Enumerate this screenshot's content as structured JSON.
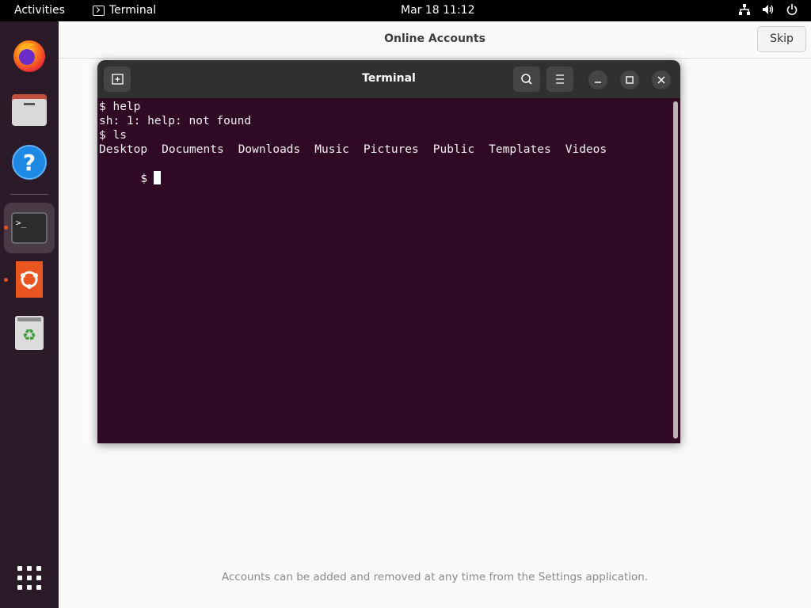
{
  "topbar": {
    "activities": "Activities",
    "app_name": "Terminal",
    "clock": "Mar 18  11:12",
    "tray_icons": [
      "network-icon",
      "volume-icon",
      "power-icon"
    ]
  },
  "dock": {
    "items": [
      {
        "name": "firefox",
        "icon": "firefox-icon"
      },
      {
        "name": "files",
        "icon": "files-icon"
      },
      {
        "name": "help",
        "icon": "help-icon"
      },
      {
        "name": "terminal",
        "icon": "terminal-icon",
        "active": true
      },
      {
        "name": "ubuntu-software",
        "icon": "ubuntu-icon",
        "running": true
      },
      {
        "name": "trash",
        "icon": "trash-icon"
      },
      {
        "name": "show-applications",
        "icon": "grid-icon"
      }
    ]
  },
  "online_accounts": {
    "title": "Online Accounts",
    "skip_label": "Skip",
    "footer": "Accounts can be added and removed at any time from the Settings application."
  },
  "terminal": {
    "title": "Terminal",
    "lines": [
      "$ help",
      "sh: 1: help: not found",
      "$ ls"
    ],
    "ls_output": [
      "Desktop",
      "Documents",
      "Downloads",
      "Music",
      "Pictures",
      "Public",
      "Templates",
      "Videos"
    ],
    "prompt": "$"
  },
  "colors": {
    "accent": "#e95420",
    "terminal_bg": "#300a24",
    "header_bg": "#303030"
  }
}
